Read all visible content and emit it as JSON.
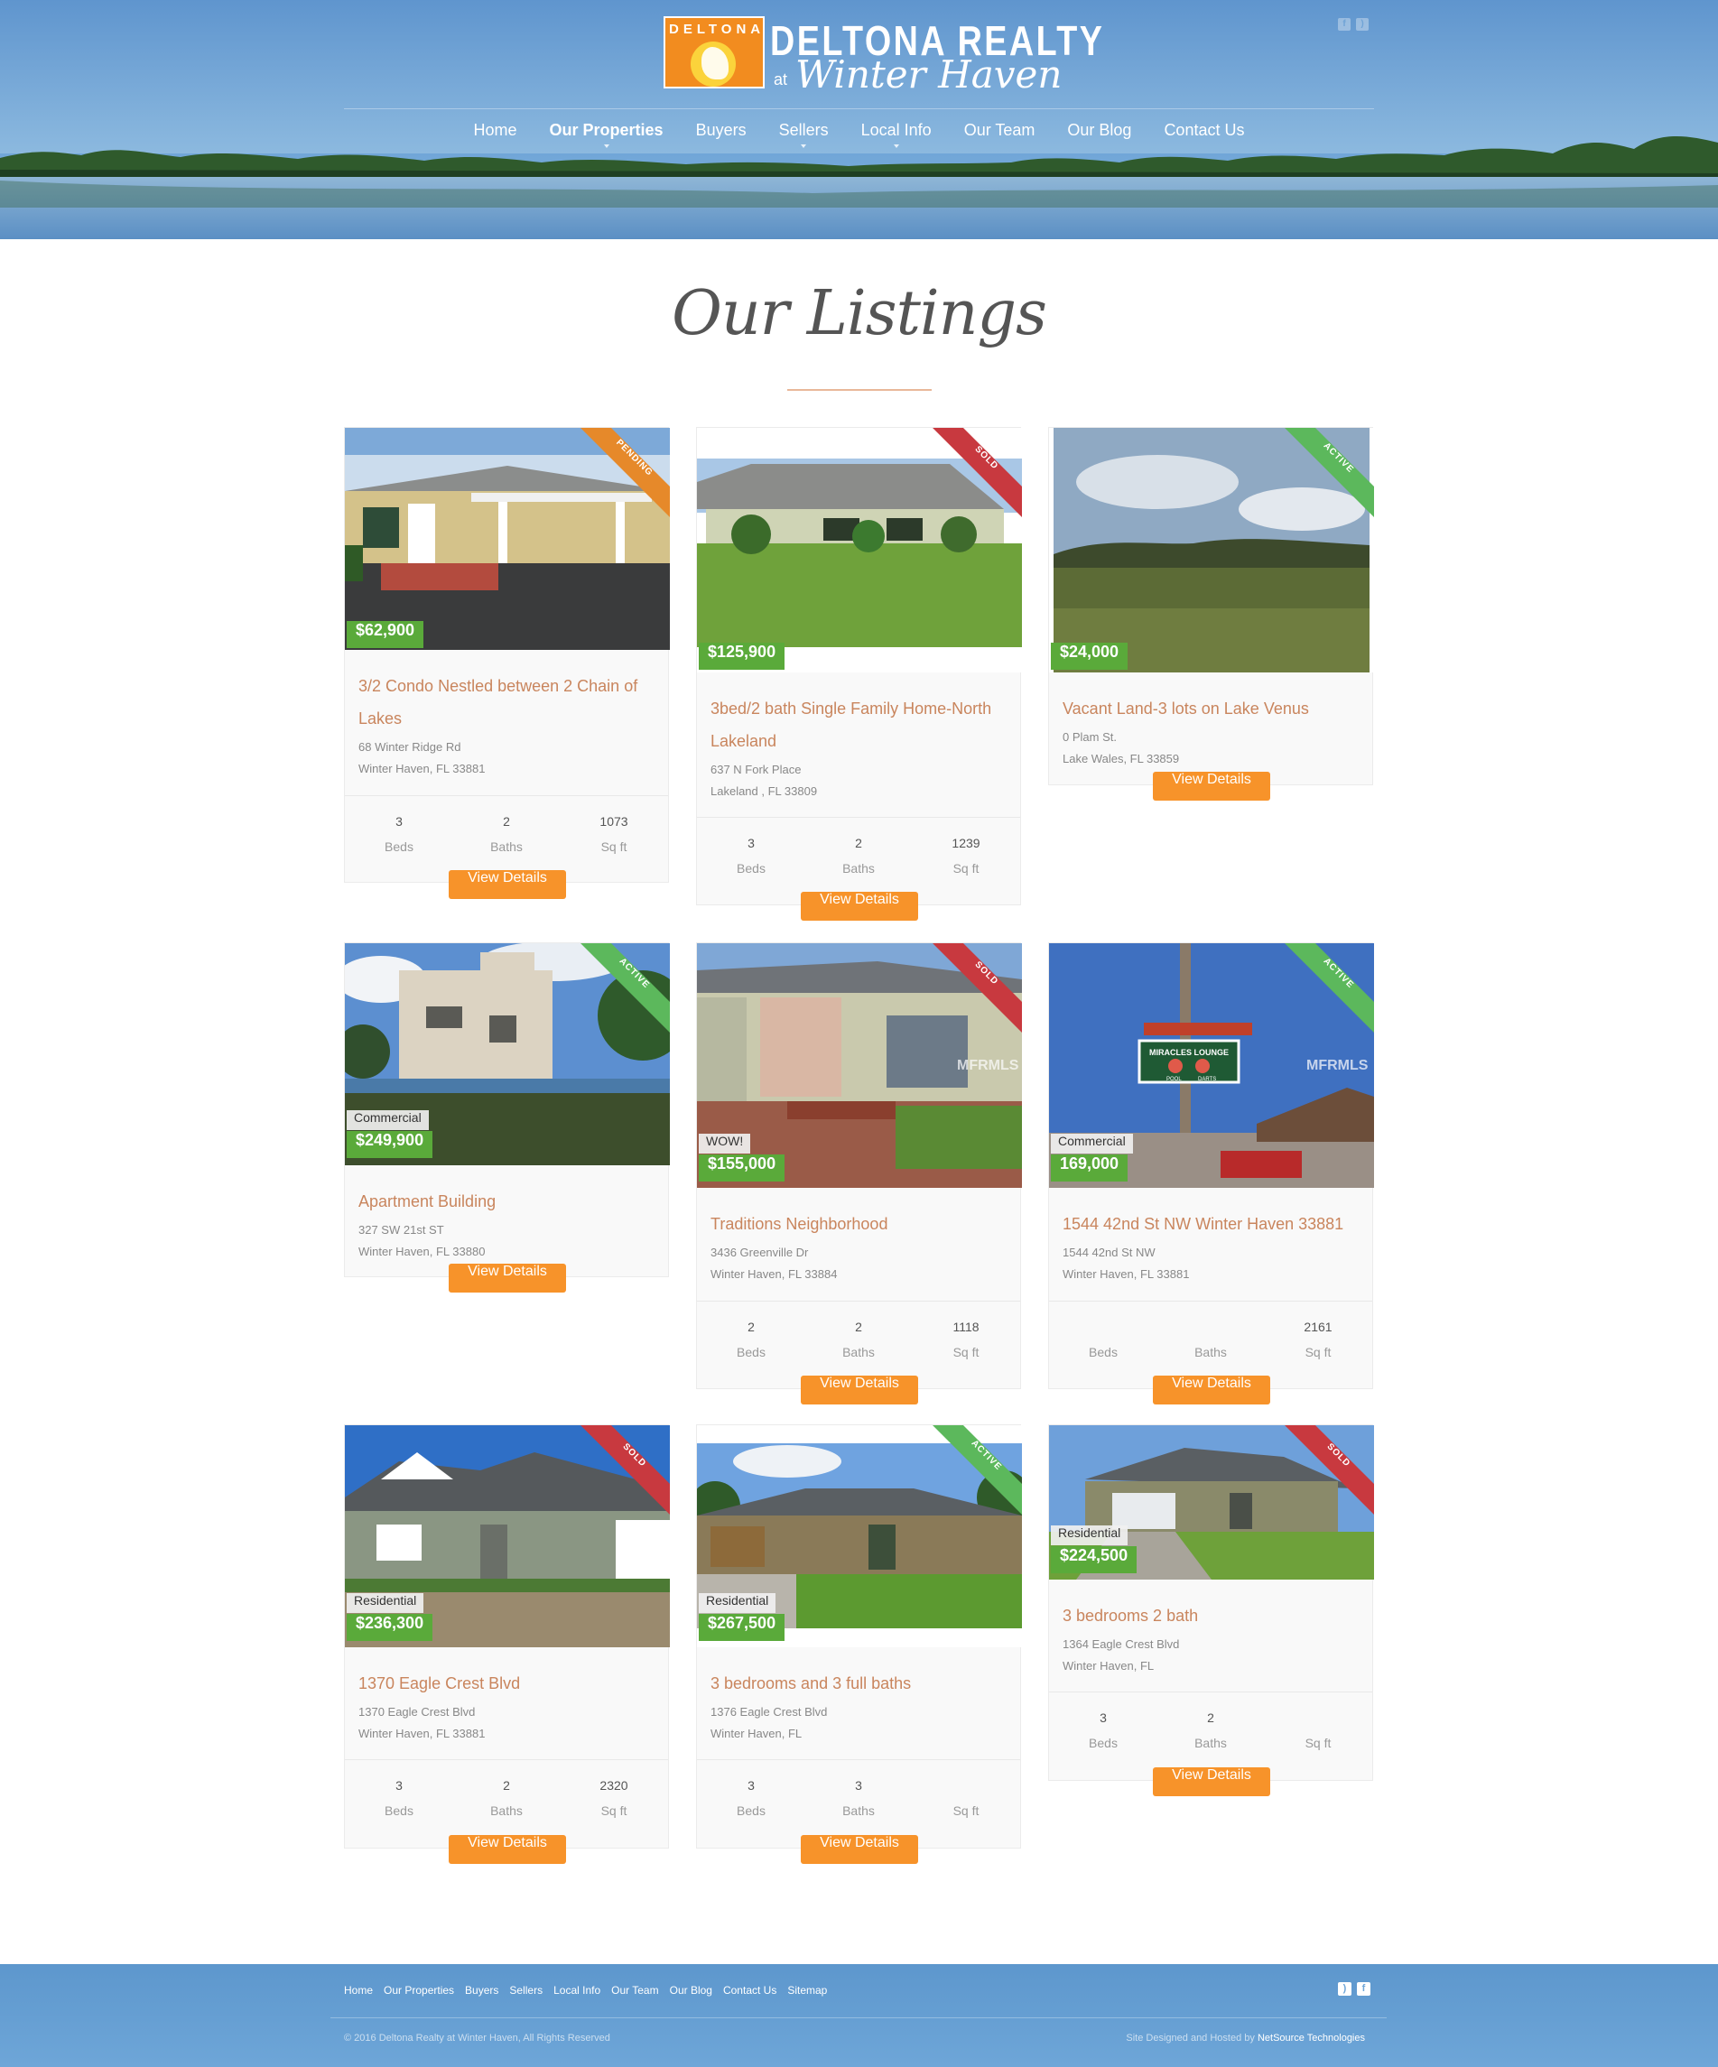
{
  "header": {
    "logo_badge": "DELTONA",
    "brand": "DELTONA REALTY",
    "brand_at": "at",
    "brand_script": "Winter Haven",
    "nav": [
      {
        "label": "Home"
      },
      {
        "label": "Our Properties"
      },
      {
        "label": "Buyers"
      },
      {
        "label": "Sellers"
      },
      {
        "label": "Local Info"
      },
      {
        "label": "Our Team"
      },
      {
        "label": "Our Blog"
      },
      {
        "label": "Contact Us"
      }
    ],
    "social": [
      "facebook-icon",
      "rss-icon"
    ]
  },
  "page": {
    "title": "Our Listings"
  },
  "labels": {
    "beds": "Beds",
    "baths": "Baths",
    "sqft": "Sq ft",
    "view_details": "View Details"
  },
  "listings": [
    {
      "status": "PENDING",
      "price": "$62,900",
      "type": "",
      "title_line1": "3/2 Condo Nestled between 2 Chain of",
      "title_line2": "Lakes",
      "address1": "68 Winter Ridge Rd",
      "address2": "Winter Haven, FL 33881",
      "beds": "3",
      "baths": "2",
      "sqft": "1073"
    },
    {
      "status": "SOLD",
      "price": "$125,900",
      "type": "",
      "title_line1": "3bed/2 bath Single Family Home-North",
      "title_line2": "Lakeland",
      "address1": "637 N Fork Place",
      "address2": "Lakeland , FL 33809",
      "beds": "3",
      "baths": "2",
      "sqft": "1239"
    },
    {
      "status": "ACTIVE",
      "price": "$24,000",
      "type": "",
      "title_line1": "Vacant Land-3 lots on Lake Venus",
      "title_line2": "",
      "address1": "0 Plam St.",
      "address2": "Lake Wales, FL 33859",
      "beds": "",
      "baths": "",
      "sqft": ""
    },
    {
      "status": "ACTIVE",
      "price": "$249,900",
      "type": "Commercial",
      "title_line1": "Apartment Building",
      "title_line2": "",
      "address1": "327 SW 21st ST",
      "address2": "Winter Haven, FL 33880",
      "beds": "",
      "baths": "",
      "sqft": ""
    },
    {
      "status": "SOLD",
      "price": "$155,000",
      "type": "WOW!",
      "title_line1": "Traditions Neighborhood",
      "title_line2": "",
      "address1": "3436 Greenville Dr",
      "address2": "Winter Haven, FL 33884",
      "beds": "2",
      "baths": "2",
      "sqft": "1118",
      "watermark": "MFRMLS"
    },
    {
      "status": "ACTIVE",
      "price": "169,000",
      "type": "Commercial",
      "title_line1": "1544 42nd St NW Winter Haven 33881",
      "title_line2": "",
      "address1": "1544 42nd St NW",
      "address2": "Winter Haven, FL 33881",
      "beds": "",
      "baths": "",
      "sqft": "2161",
      "watermark": "MFRMLS",
      "sign_text": "MIRACLES LOUNGE",
      "sign_sub1": "POOL",
      "sign_sub2": "DARTS"
    },
    {
      "status": "SOLD",
      "price": "$236,300",
      "type": "Residential",
      "title_line1": "1370 Eagle Crest Blvd",
      "title_line2": "",
      "address1": "1370 Eagle Crest Blvd",
      "address2": "Winter Haven, FL 33881",
      "beds": "3",
      "baths": "2",
      "sqft": "2320"
    },
    {
      "status": "ACTIVE",
      "price": "$267,500",
      "type": "Residential",
      "title_line1": "3 bedrooms and 3 full baths",
      "title_line2": "",
      "address1": "1376 Eagle Crest Blvd",
      "address2": "Winter Haven, FL",
      "beds": "3",
      "baths": "3",
      "sqft": ""
    },
    {
      "status": "SOLD",
      "price": "$224,500",
      "type": "Residential",
      "title_line1": "3 bedrooms 2 bath",
      "title_line2": "",
      "address1": "1364 Eagle Crest Blvd",
      "address2": "Winter Haven, FL",
      "beds": "3",
      "baths": "2",
      "sqft": ""
    }
  ],
  "footer": {
    "nav": [
      "Home",
      "Our Properties",
      "Buyers",
      "Sellers",
      "Local Info",
      "Our Team",
      "Our Blog",
      "Contact Us",
      "Sitemap"
    ],
    "copyright": "© 2016 Deltona Realty at Winter Haven, All Rights Reserved",
    "credit_prefix": "Site Designed and Hosted by",
    "credit_link": "NetSource Technologies",
    "social": [
      "rss-icon",
      "facebook-icon"
    ]
  },
  "colors": {
    "accent": "#f7932a",
    "price_bg": "#5aaa3a",
    "title_link": "#c9855d",
    "sold": "#c8393f",
    "active": "#5cb85c",
    "pending": "#e6892a",
    "header_blue": "#6aa1d6"
  }
}
